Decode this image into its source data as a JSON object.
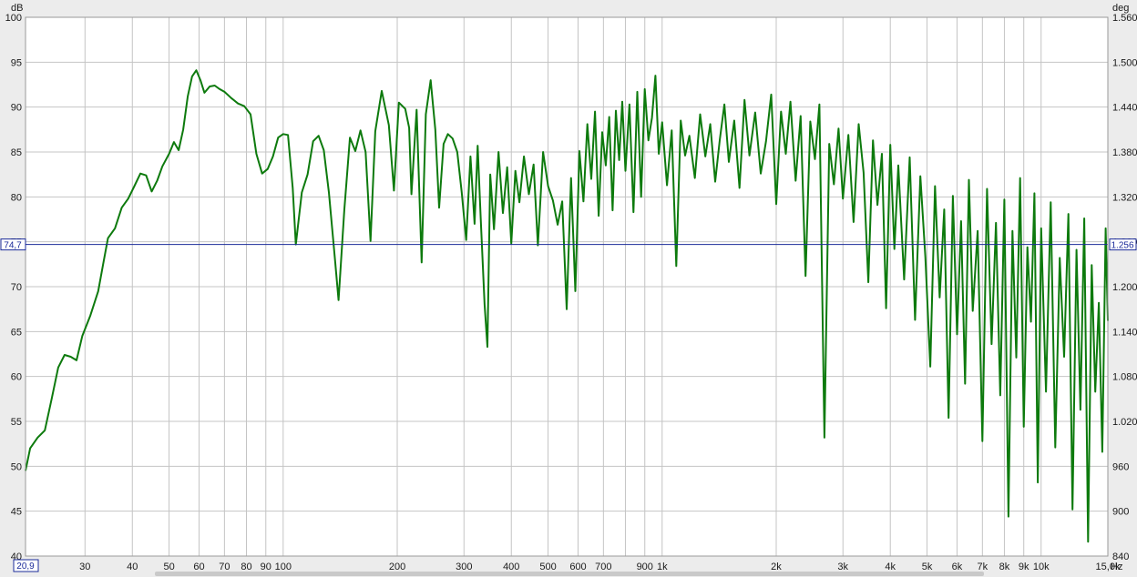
{
  "chart_data": {
    "type": "line",
    "title": "",
    "xlabel": "Hz",
    "ylabel": "dB",
    "y2label": "deg",
    "x_scale": "log",
    "xlim": [
      20.9,
      15000
    ],
    "ylim": [
      40,
      100
    ],
    "y2lim": [
      840,
      1560
    ],
    "grid": true,
    "x_tick_labels": [
      {
        "v": 30,
        "t": "30"
      },
      {
        "v": 40,
        "t": "40"
      },
      {
        "v": 50,
        "t": "50"
      },
      {
        "v": 60,
        "t": "60"
      },
      {
        "v": 70,
        "t": "70"
      },
      {
        "v": 80,
        "t": "80"
      },
      {
        "v": 90,
        "t": "90"
      },
      {
        "v": 100,
        "t": "100"
      },
      {
        "v": 200,
        "t": "200"
      },
      {
        "v": 300,
        "t": "300"
      },
      {
        "v": 400,
        "t": "400"
      },
      {
        "v": 500,
        "t": "500"
      },
      {
        "v": 600,
        "t": "600"
      },
      {
        "v": 700,
        "t": "700"
      },
      {
        "v": 900,
        "t": "900"
      },
      {
        "v": 1000,
        "t": "1k"
      },
      {
        "v": 2000,
        "t": "2k"
      },
      {
        "v": 3000,
        "t": "3k"
      },
      {
        "v": 4000,
        "t": "4k"
      },
      {
        "v": 5000,
        "t": "5k"
      },
      {
        "v": 6000,
        "t": "6k"
      },
      {
        "v": 7000,
        "t": "7k"
      },
      {
        "v": 8000,
        "t": "8k"
      },
      {
        "v": 9000,
        "t": "9k"
      },
      {
        "v": 10000,
        "t": "10k"
      },
      {
        "v": 15000,
        "t": "15,0k"
      }
    ],
    "x_minor_grid": [
      30,
      40,
      50,
      60,
      70,
      80,
      90,
      100,
      200,
      300,
      400,
      500,
      600,
      700,
      800,
      900,
      1000,
      2000,
      3000,
      4000,
      5000,
      6000,
      7000,
      8000,
      9000,
      10000
    ],
    "y_ticks": [
      40,
      45,
      50,
      55,
      60,
      65,
      70,
      75,
      80,
      85,
      90,
      95,
      100
    ],
    "y2_ticks": [
      "840",
      "900",
      "960",
      "1.020",
      "1.080",
      "1.140",
      "1.200",
      "1.260",
      "1.320",
      "1.380",
      "1.440",
      "1.500",
      "1.560"
    ],
    "cursor": {
      "y_label": "74,7",
      "y2_label": "1.256",
      "x_label": "20,9",
      "y_value": 74.7
    },
    "series": [
      {
        "color": "#0d7a0d",
        "points": [
          [
            20.9,
            49.5
          ],
          [
            21.5,
            52
          ],
          [
            22.5,
            53.2
          ],
          [
            23.5,
            54
          ],
          [
            24.5,
            57.5
          ],
          [
            25.5,
            61
          ],
          [
            26.5,
            62.4
          ],
          [
            27.5,
            62.2
          ],
          [
            28.5,
            61.8
          ],
          [
            29.5,
            64.5
          ],
          [
            31,
            66.8
          ],
          [
            32.5,
            69.5
          ],
          [
            33.5,
            72.5
          ],
          [
            34.5,
            75.4
          ],
          [
            36,
            76.5
          ],
          [
            37.5,
            78.8
          ],
          [
            39,
            79.8
          ],
          [
            40.5,
            81.2
          ],
          [
            42,
            82.6
          ],
          [
            43.5,
            82.4
          ],
          [
            45,
            80.6
          ],
          [
            46.5,
            81.8
          ],
          [
            48,
            83.4
          ],
          [
            50,
            84.8
          ],
          [
            51.5,
            86.1
          ],
          [
            53,
            85.2
          ],
          [
            54.5,
            87.5
          ],
          [
            56,
            91.2
          ],
          [
            57.5,
            93.4
          ],
          [
            59,
            94.1
          ],
          [
            60.5,
            93
          ],
          [
            62,
            91.6
          ],
          [
            64,
            92.3
          ],
          [
            66,
            92.4
          ],
          [
            68,
            92
          ],
          [
            70,
            91.7
          ],
          [
            73,
            91
          ],
          [
            76,
            90.4
          ],
          [
            79,
            90.1
          ],
          [
            82,
            89.2
          ],
          [
            85,
            84.8
          ],
          [
            88,
            82.6
          ],
          [
            91,
            83.1
          ],
          [
            94,
            84.5
          ],
          [
            97,
            86.6
          ],
          [
            100,
            87
          ],
          [
            103,
            86.9
          ],
          [
            106,
            81
          ],
          [
            108,
            74.7
          ],
          [
            112,
            80.5
          ],
          [
            116,
            82.5
          ],
          [
            120,
            86.2
          ],
          [
            124,
            86.8
          ],
          [
            128,
            85.2
          ],
          [
            132,
            80.5
          ],
          [
            137,
            73
          ],
          [
            140,
            68.5
          ],
          [
            145,
            78.5
          ],
          [
            150,
            86.6
          ],
          [
            155,
            85.1
          ],
          [
            160,
            87.4
          ],
          [
            165,
            85
          ],
          [
            170,
            75.1
          ],
          [
            175,
            87.3
          ],
          [
            182,
            91.8
          ],
          [
            190,
            88
          ],
          [
            196,
            80.7
          ],
          [
            202,
            90.5
          ],
          [
            210,
            89.8
          ],
          [
            215,
            87.7
          ],
          [
            218,
            80.3
          ],
          [
            225,
            89.7
          ],
          [
            232,
            72.7
          ],
          [
            238,
            89.2
          ],
          [
            245,
            93
          ],
          [
            252,
            87.5
          ],
          [
            258,
            78.8
          ],
          [
            265,
            85.9
          ],
          [
            272,
            87
          ],
          [
            280,
            86.5
          ],
          [
            288,
            85
          ],
          [
            296,
            80.5
          ],
          [
            304,
            75.2
          ],
          [
            312,
            84.5
          ],
          [
            320,
            77
          ],
          [
            326,
            85.7
          ],
          [
            332,
            77.7
          ],
          [
            340,
            68
          ],
          [
            346,
            63.3
          ],
          [
            352,
            82.5
          ],
          [
            360,
            76.4
          ],
          [
            370,
            85
          ],
          [
            380,
            78.2
          ],
          [
            390,
            83.3
          ],
          [
            400,
            74.8
          ],
          [
            410,
            82.9
          ],
          [
            420,
            79.4
          ],
          [
            432,
            84.5
          ],
          [
            445,
            80.3
          ],
          [
            458,
            83.6
          ],
          [
            470,
            74.6
          ],
          [
            485,
            85
          ],
          [
            500,
            81.2
          ],
          [
            515,
            79.6
          ],
          [
            530,
            76.9
          ],
          [
            545,
            79.5
          ],
          [
            560,
            67.5
          ],
          [
            575,
            82.1
          ],
          [
            590,
            69.5
          ],
          [
            605,
            85.1
          ],
          [
            620,
            79.5
          ],
          [
            635,
            88.1
          ],
          [
            650,
            82
          ],
          [
            665,
            89.5
          ],
          [
            680,
            77.9
          ],
          [
            695,
            87.2
          ],
          [
            710,
            83.5
          ],
          [
            725,
            88.9
          ],
          [
            740,
            78.5
          ],
          [
            755,
            89.6
          ],
          [
            770,
            84.1
          ],
          [
            785,
            90.6
          ],
          [
            800,
            82.9
          ],
          [
            820,
            90.3
          ],
          [
            840,
            78.3
          ],
          [
            860,
            91.7
          ],
          [
            880,
            80
          ],
          [
            900,
            92
          ],
          [
            920,
            86.3
          ],
          [
            940,
            88.8
          ],
          [
            960,
            93.5
          ],
          [
            980,
            84.8
          ],
          [
            1000,
            88.3
          ],
          [
            1030,
            81.3
          ],
          [
            1060,
            87.4
          ],
          [
            1090,
            72.3
          ],
          [
            1120,
            88.5
          ],
          [
            1150,
            84.6
          ],
          [
            1180,
            86.8
          ],
          [
            1220,
            82.1
          ],
          [
            1260,
            89.2
          ],
          [
            1300,
            84.5
          ],
          [
            1340,
            88.1
          ],
          [
            1380,
            81.7
          ],
          [
            1420,
            86.4
          ],
          [
            1460,
            90.3
          ],
          [
            1500,
            83.9
          ],
          [
            1550,
            88.5
          ],
          [
            1600,
            81
          ],
          [
            1650,
            90.8
          ],
          [
            1700,
            84.6
          ],
          [
            1760,
            89.4
          ],
          [
            1820,
            82.6
          ],
          [
            1880,
            86.2
          ],
          [
            1940,
            91.4
          ],
          [
            2000,
            79.2
          ],
          [
            2060,
            89.5
          ],
          [
            2120,
            84.8
          ],
          [
            2180,
            90.6
          ],
          [
            2250,
            81.8
          ],
          [
            2320,
            89
          ],
          [
            2390,
            71.2
          ],
          [
            2460,
            88.4
          ],
          [
            2530,
            84.2
          ],
          [
            2600,
            90.3
          ],
          [
            2680,
            53.2
          ],
          [
            2760,
            85.9
          ],
          [
            2840,
            81.4
          ],
          [
            2920,
            87.6
          ],
          [
            3000,
            79.8
          ],
          [
            3100,
            86.9
          ],
          [
            3200,
            77.2
          ],
          [
            3300,
            88.1
          ],
          [
            3400,
            82.7
          ],
          [
            3500,
            70.5
          ],
          [
            3600,
            86.3
          ],
          [
            3700,
            79.1
          ],
          [
            3800,
            84.8
          ],
          [
            3900,
            67.6
          ],
          [
            4000,
            85.8
          ],
          [
            4100,
            74.2
          ],
          [
            4200,
            83.5
          ],
          [
            4350,
            70.8
          ],
          [
            4500,
            84.4
          ],
          [
            4650,
            66.3
          ],
          [
            4800,
            82.3
          ],
          [
            4950,
            73.3
          ],
          [
            5100,
            61.1
          ],
          [
            5250,
            81.2
          ],
          [
            5400,
            68.8
          ],
          [
            5550,
            78.6
          ],
          [
            5700,
            55.4
          ],
          [
            5850,
            80.1
          ],
          [
            6000,
            64.7
          ],
          [
            6150,
            77.3
          ],
          [
            6300,
            59.2
          ],
          [
            6450,
            81.9
          ],
          [
            6600,
            67.3
          ],
          [
            6800,
            76.2
          ],
          [
            7000,
            52.8
          ],
          [
            7200,
            80.9
          ],
          [
            7400,
            63.6
          ],
          [
            7600,
            77.1
          ],
          [
            7800,
            57.9
          ],
          [
            8000,
            79.7
          ],
          [
            8200,
            44.4
          ],
          [
            8400,
            76.2
          ],
          [
            8600,
            62.1
          ],
          [
            8800,
            82.1
          ],
          [
            9000,
            54.4
          ],
          [
            9200,
            74.4
          ],
          [
            9400,
            66.1
          ],
          [
            9600,
            80.4
          ],
          [
            9800,
            48.2
          ],
          [
            10000,
            76.5
          ],
          [
            10300,
            58.3
          ],
          [
            10600,
            79.4
          ],
          [
            10900,
            52.1
          ],
          [
            11200,
            73.2
          ],
          [
            11500,
            62.2
          ],
          [
            11800,
            78.1
          ],
          [
            12100,
            45.2
          ],
          [
            12400,
            74.1
          ],
          [
            12700,
            56.3
          ],
          [
            13000,
            77.6
          ],
          [
            13300,
            41.6
          ],
          [
            13600,
            72.4
          ],
          [
            13900,
            58.3
          ],
          [
            14200,
            68.2
          ],
          [
            14500,
            51.6
          ],
          [
            14800,
            76.5
          ],
          [
            15000,
            66.2
          ]
        ]
      }
    ]
  }
}
